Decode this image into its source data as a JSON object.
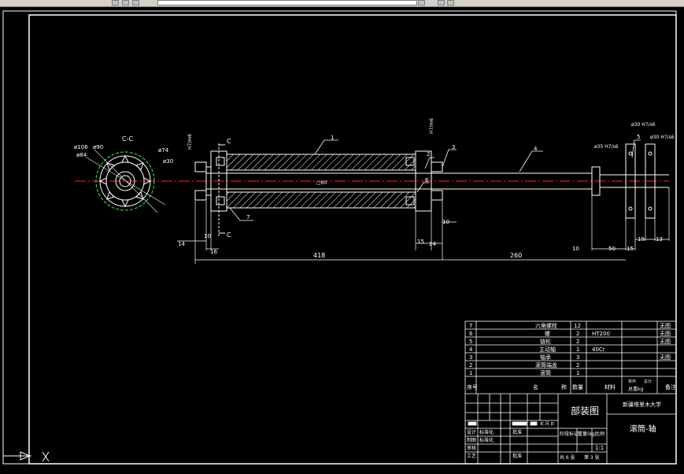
{
  "toolbar": {
    "icons": [
      "layers-icon",
      "properties-icon",
      "layer-state-icon",
      "freeze-layer-icon",
      "lock-layer-icon",
      "color-square-icon",
      "dropdown-arrow-icon"
    ]
  },
  "drawing": {
    "section_label": "C-C",
    "section_mark": "C",
    "section_dims": [
      "ø106",
      "ø90",
      "ø84",
      "ø74",
      "ø30"
    ],
    "part_callouts": [
      "1",
      "2",
      "3",
      "4",
      "5",
      "6",
      "7"
    ],
    "fit_labels": [
      "H7/m6",
      "H7/m6",
      "ø35 H7/s6",
      "ø30 H7/s6",
      "ø30 H7/s6"
    ],
    "dims_bottom": [
      "14",
      "10",
      "16",
      "15",
      "24",
      "10",
      "418",
      "260",
      "10",
      "50",
      "15",
      "19",
      "13"
    ],
    "mid_dim": "□60"
  },
  "title_block": {
    "parts": [
      {
        "no": "7",
        "name": "六角螺栓",
        "qty": "12",
        "material": "",
        "note": "无图"
      },
      {
        "no": "6",
        "name": "螺",
        "qty": "2",
        "material": "HT200",
        "note": "无图"
      },
      {
        "no": "5",
        "name": "链轮",
        "qty": "2",
        "material": "",
        "note": "无图"
      },
      {
        "no": "4",
        "name": "主动轴",
        "qty": "1",
        "material": "40Cr",
        "note": ""
      },
      {
        "no": "3",
        "name": "轴承",
        "qty": "3",
        "material": "",
        "note": "无图"
      },
      {
        "no": "2",
        "name": "滚筒端盖",
        "qty": "2",
        "material": "",
        "note": ""
      },
      {
        "no": "1",
        "name": "滚筒",
        "qty": "1",
        "material": "",
        "note": ""
      }
    ],
    "header": {
      "no": "序号",
      "name": "名",
      "code": "称",
      "qty": "数量",
      "material": "材料",
      "weight": "总重kg",
      "note": "备注",
      "unit_single": "单件",
      "unit_total": "总计"
    },
    "assembly": "部装图",
    "school": "新疆塔里木大学",
    "drawing_name": "滚筒-轴",
    "labels": {
      "design": "设计",
      "draw": "制图",
      "check": "审核",
      "process": "工艺",
      "stage": "阶段标记",
      "weight": "重量(kg)",
      "scale": "比例",
      "standard": "标准化",
      "approve": "批准",
      "date": "年.月.日"
    },
    "scale_value": "1:1",
    "sheets": "共 6 张",
    "sheet_no": "第 3 张"
  }
}
